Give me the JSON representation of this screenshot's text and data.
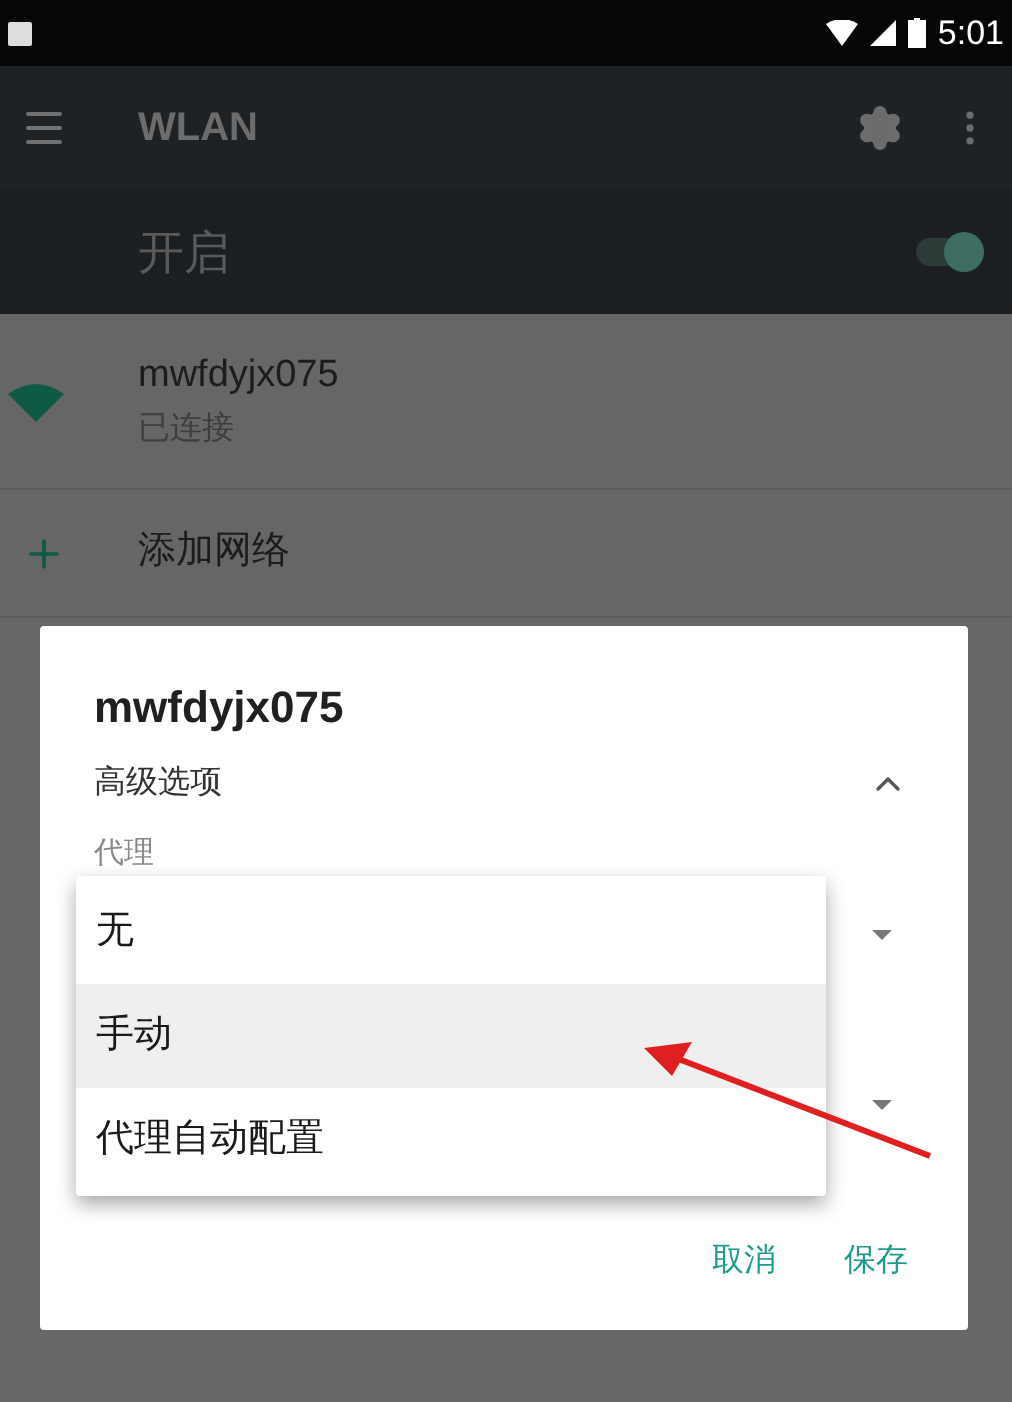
{
  "status_bar": {
    "time": "5:01"
  },
  "toolbar": {
    "title": "WLAN"
  },
  "wlan_switch": {
    "label": "开启",
    "on": true
  },
  "networks": [
    {
      "name": "mwfdyjx075",
      "status": "已连接"
    }
  ],
  "add_network": {
    "label": "添加网络"
  },
  "dialog": {
    "title": "mwfdyjx075",
    "advanced": {
      "label": "高级选项",
      "expanded": true
    },
    "proxy_label": "代理",
    "proxy_options": [
      {
        "label": "无",
        "selected": false
      },
      {
        "label": "手动",
        "selected": true
      },
      {
        "label": "代理自动配置",
        "selected": false
      }
    ],
    "buttons": [
      "取消",
      "保存"
    ]
  }
}
